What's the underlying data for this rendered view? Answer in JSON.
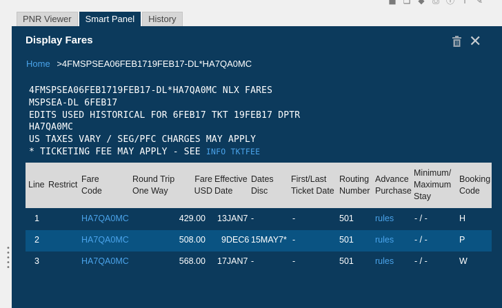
{
  "tabs": [
    "PNR Viewer",
    "Smart Panel",
    "History"
  ],
  "panel": {
    "title": "Display Fares",
    "breadcrumb": {
      "home": "Home",
      "current": ">4FMSPSEA06FEB1719FEB17-DL*HA7QA0MC"
    },
    "terminal_lines": [
      "4FMSPSEA06FEB1719FEB17-DL*HA7QA0MC NLX FARES",
      "MSPSEA-DL 6FEB17",
      "EDITS USED HISTORICAL FOR 6FEB17 TKT 19FEB17 DPTR",
      "HA7QA0MC",
      "US TAXES VARY / SEG/PFC CHARGES MAY APPLY"
    ],
    "terminal_last_prefix": "* TICKETING FEE MAY APPLY - SEE ",
    "terminal_last_link": "INFO TKTFEE"
  },
  "table": {
    "headers": {
      "line": "Line",
      "restrict": "Restrict",
      "fare_code_1": "Fare",
      "fare_code_2": "Code",
      "round_trip": "Round Trip",
      "one_way": "One Way",
      "fare_1": "Fare",
      "fare_2": "USD",
      "effective_1": "Effective",
      "effective_2": "Date",
      "dates_1": "Dates",
      "dates_2": "Disc",
      "first_last_1": "First/Last",
      "first_last_2": "Ticket Date",
      "routing_1": "Routing",
      "routing_2": "Number",
      "advance_1": "Advance",
      "advance_2": "Purchase",
      "minmax_1": "Minimum/",
      "minmax_2": "Maximum",
      "minmax_3": "Stay",
      "booking_1": "Booking",
      "booking_2": "Code"
    },
    "rows": [
      {
        "line": "1",
        "fare_code": "HA7QA0MC",
        "fare": "429.00",
        "effective": "13JAN7",
        "disc": "-",
        "first_last": "-",
        "routing": "501",
        "advance": "rules",
        "minmax": "- / -",
        "booking": "H"
      },
      {
        "line": "2",
        "fare_code": "HA7QA0MC",
        "fare": "508.00",
        "effective": "9DEC6",
        "disc": "15MAY7*",
        "first_last": "-",
        "routing": "501",
        "advance": "rules",
        "minmax": "- / -",
        "booking": "P"
      },
      {
        "line": "3",
        "fare_code": "HA7QA0MC",
        "fare": "568.00",
        "effective": "17JAN7",
        "disc": "-",
        "first_last": "-",
        "routing": "501",
        "advance": "rules",
        "minmax": "- / -",
        "booking": "W"
      }
    ]
  },
  "toolbar_icons": [
    "box-icon",
    "copy-icon",
    "tag-icon",
    "print-icon",
    "info-icon",
    "export-icon",
    "edit-icon"
  ]
}
